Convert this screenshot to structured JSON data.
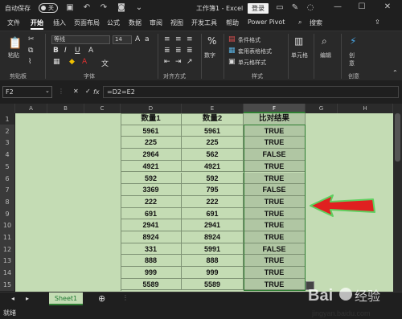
{
  "titlebar": {
    "autosave_label": "自动保存",
    "autosave_state": "关",
    "title": "工作簿1 - Excel",
    "login_label": "登录",
    "search_label": "搜索"
  },
  "menu": [
    "文件",
    "开始",
    "插入",
    "页面布局",
    "公式",
    "数据",
    "审阅",
    "视图",
    "开发工具",
    "帮助",
    "Power Pivot"
  ],
  "ribbon": {
    "paste": "粘贴",
    "clipboard": "剪贴板",
    "font_name": "等线",
    "font_size": "14",
    "font_group": "字体",
    "align_group": "对齐方式",
    "number": "数字",
    "cond_format": "条件格式",
    "table_format": "套用表格格式",
    "cell_style": "单元格样式",
    "style_group": "样式",
    "cells": "单元格",
    "editing": "编辑",
    "create": "创意",
    "create_group": "创意"
  },
  "formula": {
    "namebox": "F2",
    "fx": "fx",
    "value": "=D2=E2"
  },
  "columns": [
    "A",
    "B",
    "C",
    "D",
    "E",
    "F",
    "G",
    "H"
  ],
  "rows": [
    "1",
    "2",
    "3",
    "4",
    "5",
    "6",
    "7",
    "8",
    "9",
    "10",
    "11",
    "12",
    "13",
    "14",
    "15"
  ],
  "table": {
    "headers": [
      "数量1",
      "数量2",
      "比对结果"
    ],
    "rows": [
      [
        "5961",
        "5961",
        "TRUE"
      ],
      [
        "225",
        "225",
        "TRUE"
      ],
      [
        "2964",
        "562",
        "FALSE"
      ],
      [
        "4921",
        "4921",
        "TRUE"
      ],
      [
        "592",
        "592",
        "TRUE"
      ],
      [
        "3369",
        "795",
        "FALSE"
      ],
      [
        "222",
        "222",
        "TRUE"
      ],
      [
        "691",
        "691",
        "TRUE"
      ],
      [
        "2941",
        "2941",
        "TRUE"
      ],
      [
        "8924",
        "8924",
        "TRUE"
      ],
      [
        "331",
        "5991",
        "FALSE"
      ],
      [
        "888",
        "888",
        "TRUE"
      ],
      [
        "999",
        "999",
        "TRUE"
      ],
      [
        "5589",
        "5589",
        "TRUE"
      ]
    ]
  },
  "sheet_tab": "Sheet1",
  "status": "就绪",
  "watermark": {
    "brand": "Bai",
    "brand_cn": "经验",
    "url": "jingyan.baidu.com"
  },
  "colors": {
    "cell_bg": "#c4dcb4",
    "result_col_bg": "#b0c6a3",
    "selection": "#2e7d32",
    "arrow": "#e02020"
  }
}
